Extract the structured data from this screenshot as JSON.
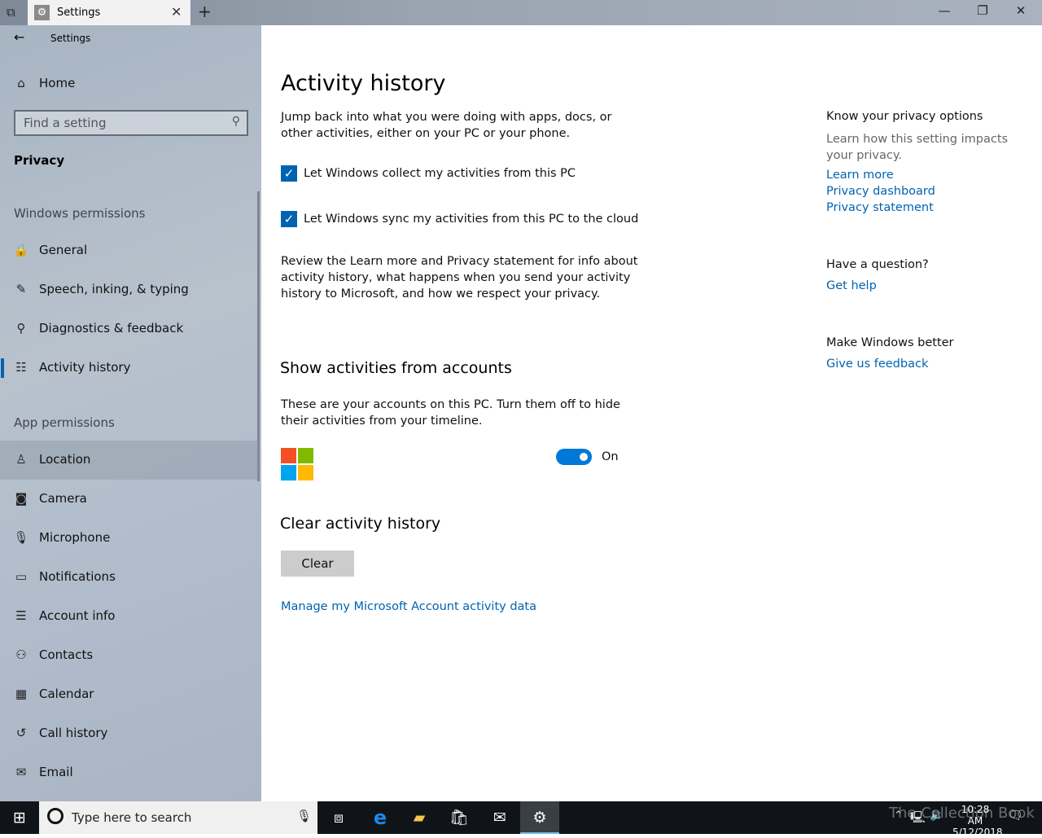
{
  "window": {
    "tab_title": "Settings",
    "new_tab": "+",
    "minimize": "—",
    "restore": "❐",
    "close": "✕",
    "tab_close": "✕"
  },
  "sidebar": {
    "back": "←",
    "app_title": "Settings",
    "home": "Home",
    "search_placeholder": "Find a setting",
    "section": "Privacy",
    "group1": "Windows permissions",
    "items1": [
      {
        "icon": "🔒",
        "label": "General"
      },
      {
        "icon": "✎",
        "label": "Speech, inking, & typing"
      },
      {
        "icon": "⚲",
        "label": "Diagnostics & feedback"
      },
      {
        "icon": "☷",
        "label": "Activity history"
      }
    ],
    "group2": "App permissions",
    "items2": [
      {
        "icon": "♙",
        "label": "Location"
      },
      {
        "icon": "◙",
        "label": "Camera"
      },
      {
        "icon": "🎙",
        "label": "Microphone"
      },
      {
        "icon": "▭",
        "label": "Notifications"
      },
      {
        "icon": "☰",
        "label": "Account info"
      },
      {
        "icon": "⚇",
        "label": "Contacts"
      },
      {
        "icon": "▦",
        "label": "Calendar"
      },
      {
        "icon": "↺",
        "label": "Call history"
      },
      {
        "icon": "✉",
        "label": "Email"
      }
    ]
  },
  "main": {
    "title": "Activity history",
    "intro": "Jump back into what you were doing with apps, docs, or other activities, either on your PC or your phone.",
    "checkbox1": {
      "label": "Let Windows collect my activities from this PC",
      "checked": true
    },
    "checkbox2": {
      "label": "Let Windows sync my activities from this PC to the cloud",
      "checked": true
    },
    "review": "Review the Learn more and Privacy statement for info about activity history, what happens when you send your activity history to Microsoft, and how we respect your privacy.",
    "accounts_heading": "Show activities from accounts",
    "accounts_desc": "These are your accounts on this PC. Turn them off to hide their activities from your timeline.",
    "toggle_state": "On",
    "clear_heading": "Clear activity history",
    "clear_button": "Clear",
    "manage_link": "Manage my Microsoft Account activity data",
    "ms_logo_colors": [
      "#f25022",
      "#7fba00",
      "#00a4ef",
      "#ffb900"
    ]
  },
  "aside": {
    "privacy_heading": "Know your privacy options",
    "privacy_desc": "Learn how this setting impacts your privacy.",
    "links": [
      "Learn more",
      "Privacy dashboard",
      "Privacy statement"
    ],
    "question_heading": "Have a question?",
    "get_help": "Get help",
    "better_heading": "Make Windows better",
    "feedback": "Give us feedback"
  },
  "taskbar": {
    "search_placeholder": "Type here to search",
    "time": "10:28 AM",
    "date": "5/12/2018",
    "watermark": "The Collection Book"
  },
  "colors": {
    "accent": "#0063b1",
    "link": "#0063b1",
    "taskbar": "#101418"
  }
}
